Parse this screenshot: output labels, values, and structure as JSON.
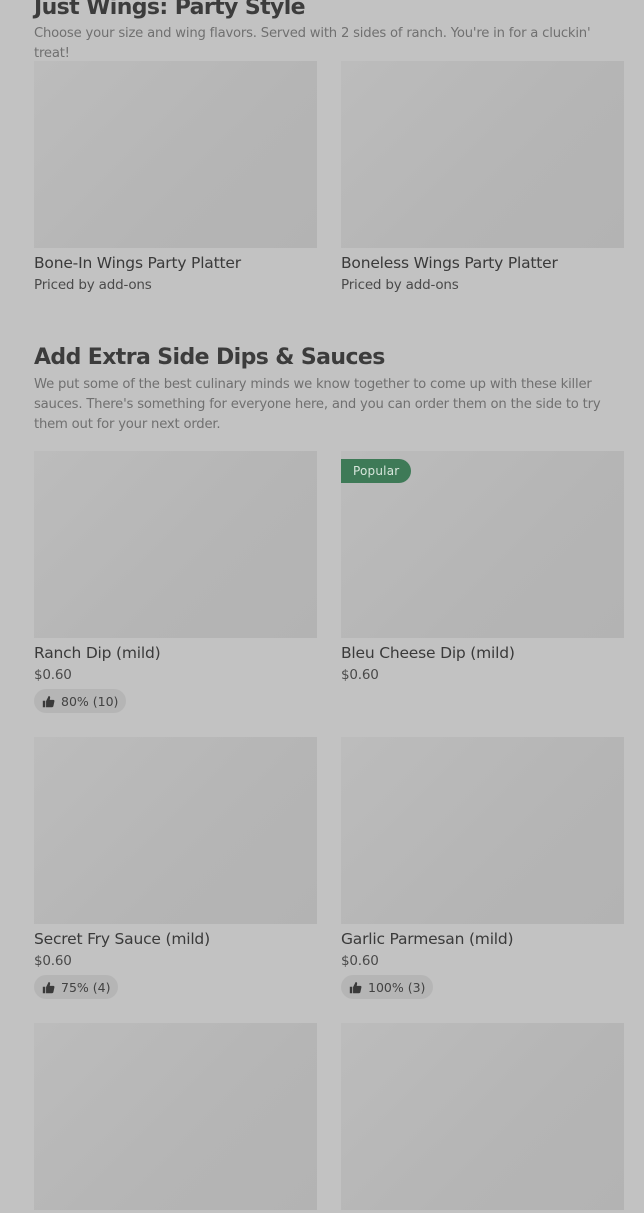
{
  "section_wings": {
    "title": "Just Wings: Party Style",
    "description": "Choose your size and wing flavors. Served with 2 sides of ranch. You're in for a cluckin' treat!",
    "items": [
      {
        "name": "Bone-In Wings Party Platter",
        "price": "Priced by add-ons"
      },
      {
        "name": "Boneless Wings Party Platter",
        "price": "Priced by add-ons"
      }
    ]
  },
  "section_dips": {
    "title": "Add Extra Side Dips & Sauces",
    "description": "We put some of the best culinary minds we know together to come up with these killer sauces. There's something for everyone here, and you can order them on the side to try them out for your next order.",
    "items": [
      {
        "name": "Ranch Dip (mild)",
        "price": "$0.60",
        "rating": "80% (10)"
      },
      {
        "name": "Bleu Cheese Dip (mild)",
        "price": "$0.60",
        "badge": "Popular"
      },
      {
        "name": "Secret Fry Sauce (mild)",
        "price": "$0.60",
        "rating": "75% (4)"
      },
      {
        "name": "Garlic Parmesan (mild)",
        "price": "$0.60",
        "rating": "100% (3)"
      }
    ]
  },
  "colors": {
    "page_background": "#c2c2c2",
    "image_placeholder": "#b8b8b8",
    "popular_badge": "#3e7a57",
    "rating_pill": "#b5b5b5"
  },
  "icons": {
    "rating": "thumbs-up-icon"
  }
}
